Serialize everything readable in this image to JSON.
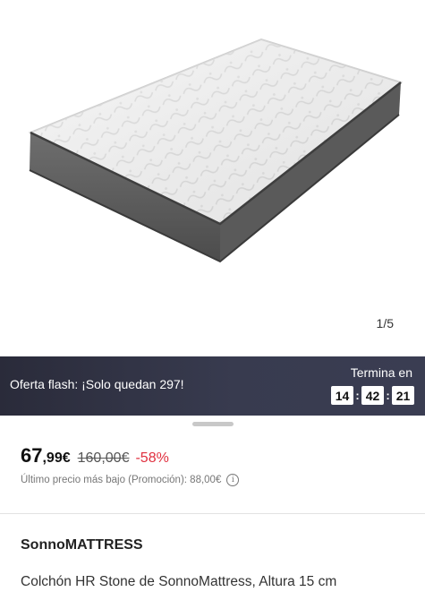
{
  "gallery": {
    "counter": "1/5"
  },
  "flash": {
    "text": "Oferta flash: ¡Solo quedan 297!",
    "ends_label": "Termina en",
    "hours": "14",
    "minutes": "42",
    "seconds": "21",
    "separator": ":"
  },
  "price": {
    "current_int": "67",
    "current_dec": ",99€",
    "original": "160,00€",
    "discount": "-58%",
    "lowest_note": "Último precio más bajo (Promoción): 88,00€"
  },
  "product": {
    "brand": "SonnoMATTRESS",
    "title": "Colchón HR Stone de SonnoMattress, Altura 15 cm"
  },
  "colors": {
    "discount": "#e0303f",
    "flash_bg": "#2a2b3a"
  }
}
